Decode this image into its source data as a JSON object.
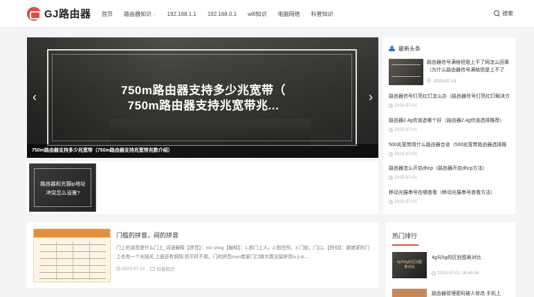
{
  "header": {
    "logo_text": "GJ路由器",
    "nav": [
      {
        "label": "首页"
      },
      {
        "label": "路由器知识"
      },
      {
        "label": "192.168.1.1"
      },
      {
        "label": "192.168.0.1"
      },
      {
        "label": "wifi知识"
      },
      {
        "label": "电脑网络"
      },
      {
        "label": "科普知识"
      }
    ],
    "search_label": "搜索"
  },
  "slider": {
    "heading_line1": "750m路由器支持多少兆宽带（",
    "heading_line2": "750m路由器支持兆宽带兆...",
    "caption": "750m路由器支持多少兆宽带（750m路由器支持兆宽带兆数介绍）",
    "prev_icon": "‹",
    "next_icon": "›"
  },
  "mini_card": {
    "title": "路由器和光猫ip地址冲突怎么设置?"
  },
  "latest": {
    "heading": "最新头条",
    "first": {
      "title": "路由器信号满格但是上不了网怎么回事（为什么路由器信号满格但是上不了",
      "date": "2023-07-01"
    },
    "items": [
      {
        "title": "路由器信号灯亮红灯怎么办（路由器信号灯亮红灯解决方",
        "date": "2023-07-01"
      },
      {
        "title": "路由器2.4g信道选哪个好（路由器2.4g信道选择推荐）",
        "date": "2023-07-01"
      },
      {
        "title": "500兆宽带用什么路由器合适（500兆宽带路由器选择推",
        "date": "2023-07-01"
      },
      {
        "title": "路由器怎么开启dhcp（路由器开启dhcp方法）",
        "date": "2023-07-01"
      },
      {
        "title": "移动光猫串号在哪查看（移动光猫串号查看方法）",
        "date": "2023-07-01"
      }
    ]
  },
  "article": {
    "title": "门槛的拼音，闾的拼音",
    "excerpt": "门上的读音是什么门上_词语解释【拼音】：mn shng【解释】：1.即门上人。2.指住所。3.门前；门口。【例句】：姥姥家的门上也有一个木插关,上面还有铜钮,但平时不用。门的拼音men老家门口喀大我没留拼音lo ji &....",
    "date": "2023-07-10",
    "category": "科普知识"
  },
  "hot": {
    "heading": "热门排行",
    "first": {
      "thumb_text": "4g与5g的区别图表对比",
      "title": "4g与5g的区别图表对比",
      "date": "2023-07-01 16:49:16"
    },
    "second": {
      "title": "路由器管理密码被人修改 手机上"
    }
  }
}
